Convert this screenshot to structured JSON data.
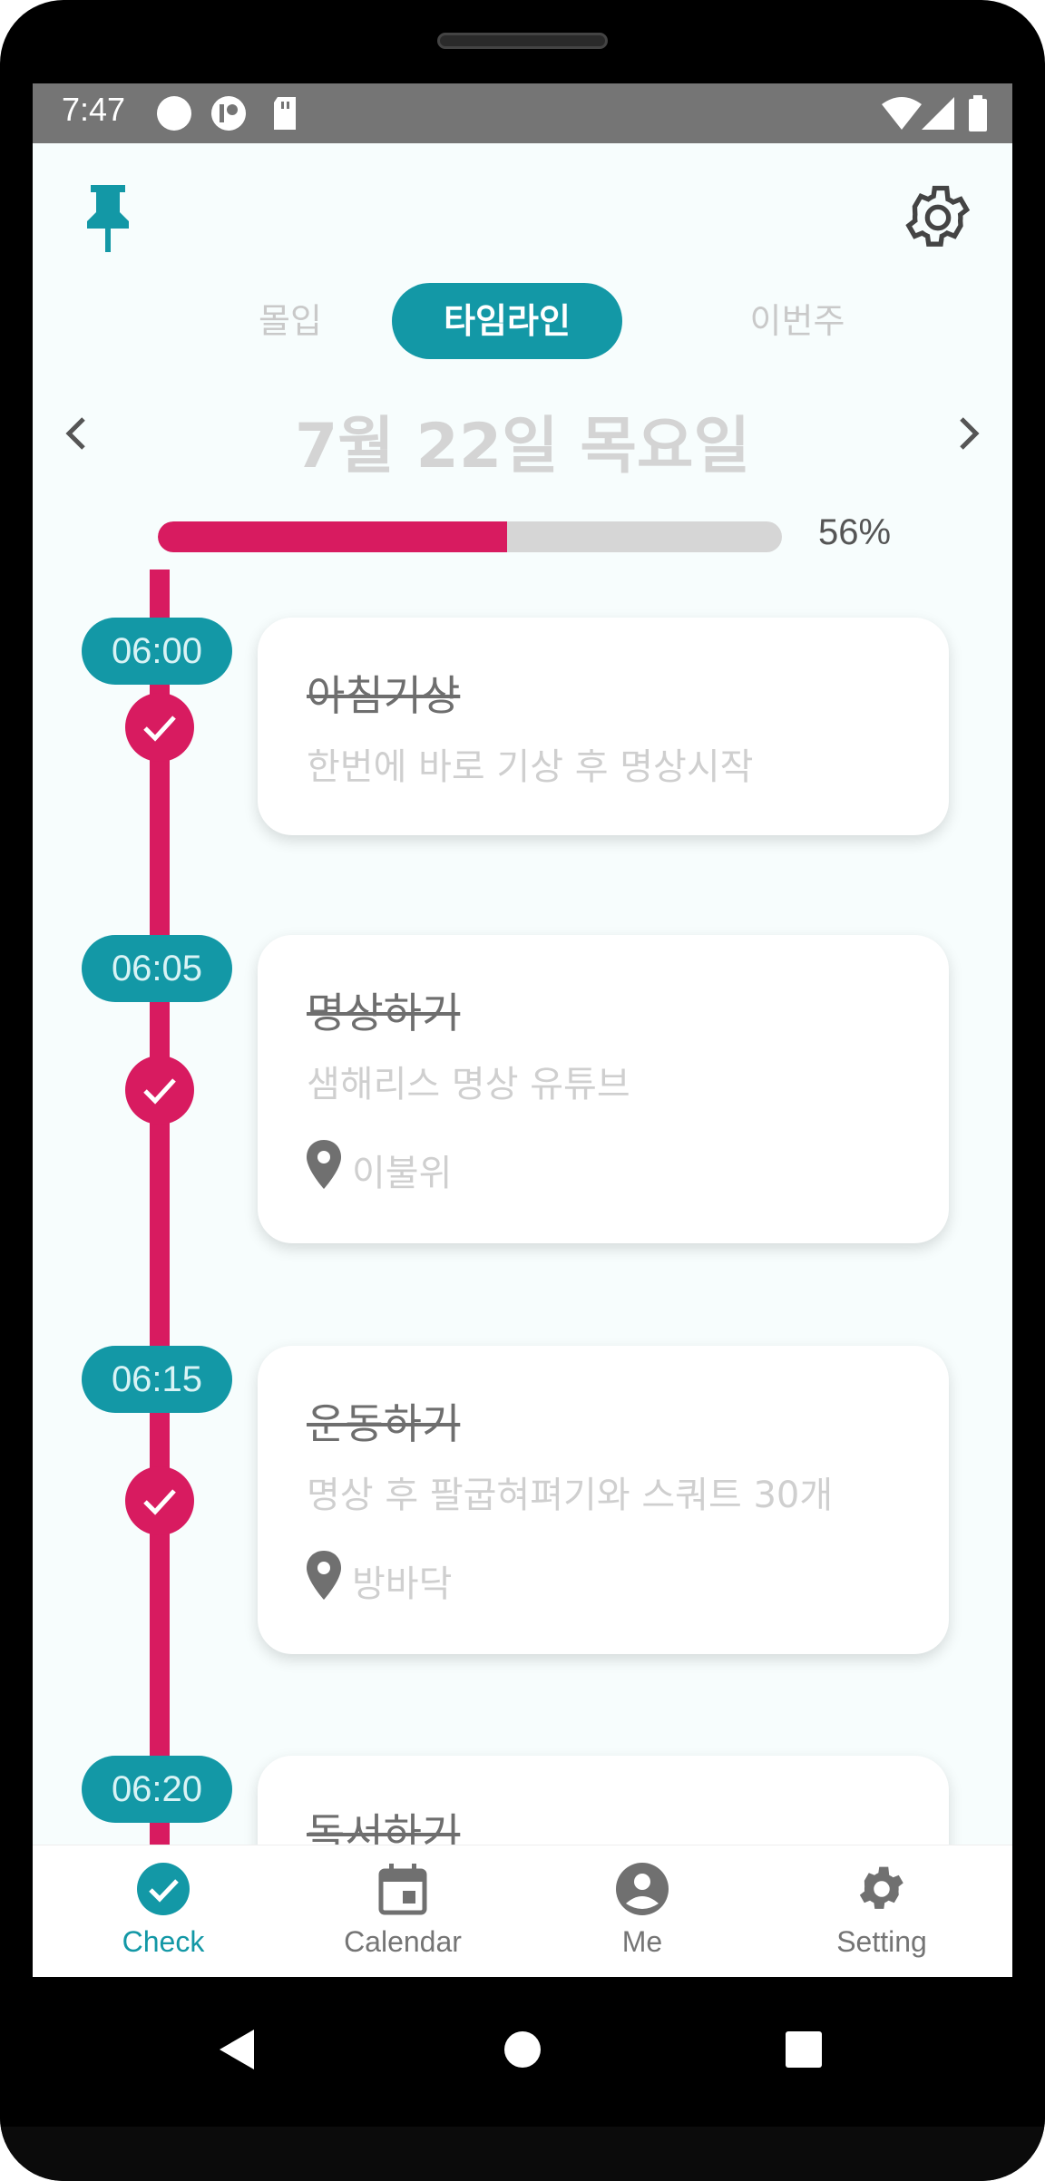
{
  "status_bar": {
    "time": "7:47"
  },
  "tabs": [
    {
      "label": "몰입",
      "active": false
    },
    {
      "label": "타임라인",
      "active": true
    },
    {
      "label": "이번주",
      "active": false
    }
  ],
  "date": {
    "label": "7월 22일 목요일"
  },
  "progress": {
    "value": 0.56,
    "label": "56%"
  },
  "timeline": [
    {
      "time": "06:00",
      "title": "아침기상",
      "desc": "한번에 바로 기상 후 명상시작",
      "location": "",
      "done": true
    },
    {
      "time": "06:05",
      "title": "명상하기",
      "desc": "샘해리스 명상 유튜브",
      "location": "이불위",
      "done": true
    },
    {
      "time": "06:15",
      "title": "운동하기",
      "desc": "명상 후 팔굽혀펴기와 스쿼트 30개",
      "location": "방바닥",
      "done": true
    },
    {
      "time": "06:20",
      "title": "독서하기",
      "desc": "",
      "location": "",
      "done": true
    }
  ],
  "bottom_nav": [
    {
      "label": "Check",
      "icon": "check-circle-icon",
      "active": true
    },
    {
      "label": "Calendar",
      "icon": "calendar-icon",
      "active": false
    },
    {
      "label": "Me",
      "icon": "account-circle-icon",
      "active": false
    },
    {
      "label": "Setting",
      "icon": "gear-icon",
      "active": false
    }
  ],
  "colors": {
    "accent": "#1398a6",
    "timeline": "#d81b60",
    "progress_track": "#d6d6d6"
  }
}
